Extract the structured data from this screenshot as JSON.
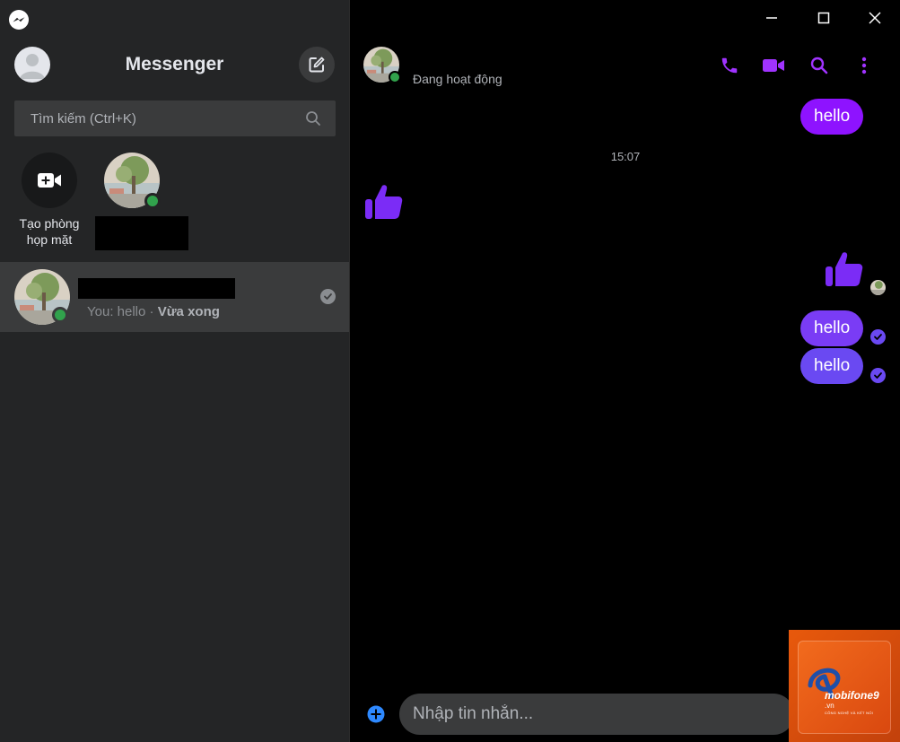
{
  "sidebar": {
    "title": "Messenger",
    "search_placeholder": "Tìm kiếm (Ctrl+K)",
    "create_room_label": "Tạo phòng họp mặt",
    "conversation": {
      "preview": "You: hello",
      "separator": " · ",
      "time": "Vừa xong"
    }
  },
  "chat": {
    "status": "Đang hoạt động",
    "timestamp": "15:07",
    "messages": [
      {
        "text": "hello"
      },
      {
        "text": "hello"
      },
      {
        "text": "hello"
      }
    ],
    "input_placeholder": "Nhập tin nhắn..."
  },
  "watermark": {
    "brand": "mobifone9",
    "domain": ".vn",
    "tagline": "CÔNG NGHỆ VÀ KẾT NỐI"
  },
  "colors": {
    "accent": "#a033ff",
    "bubble_1": "#8e13ff",
    "bubble_2": "#7a3cf5",
    "bubble_3": "#6a49f2",
    "online": "#31a24c",
    "sidebar_bg": "#242526",
    "chat_bg": "#000000"
  }
}
